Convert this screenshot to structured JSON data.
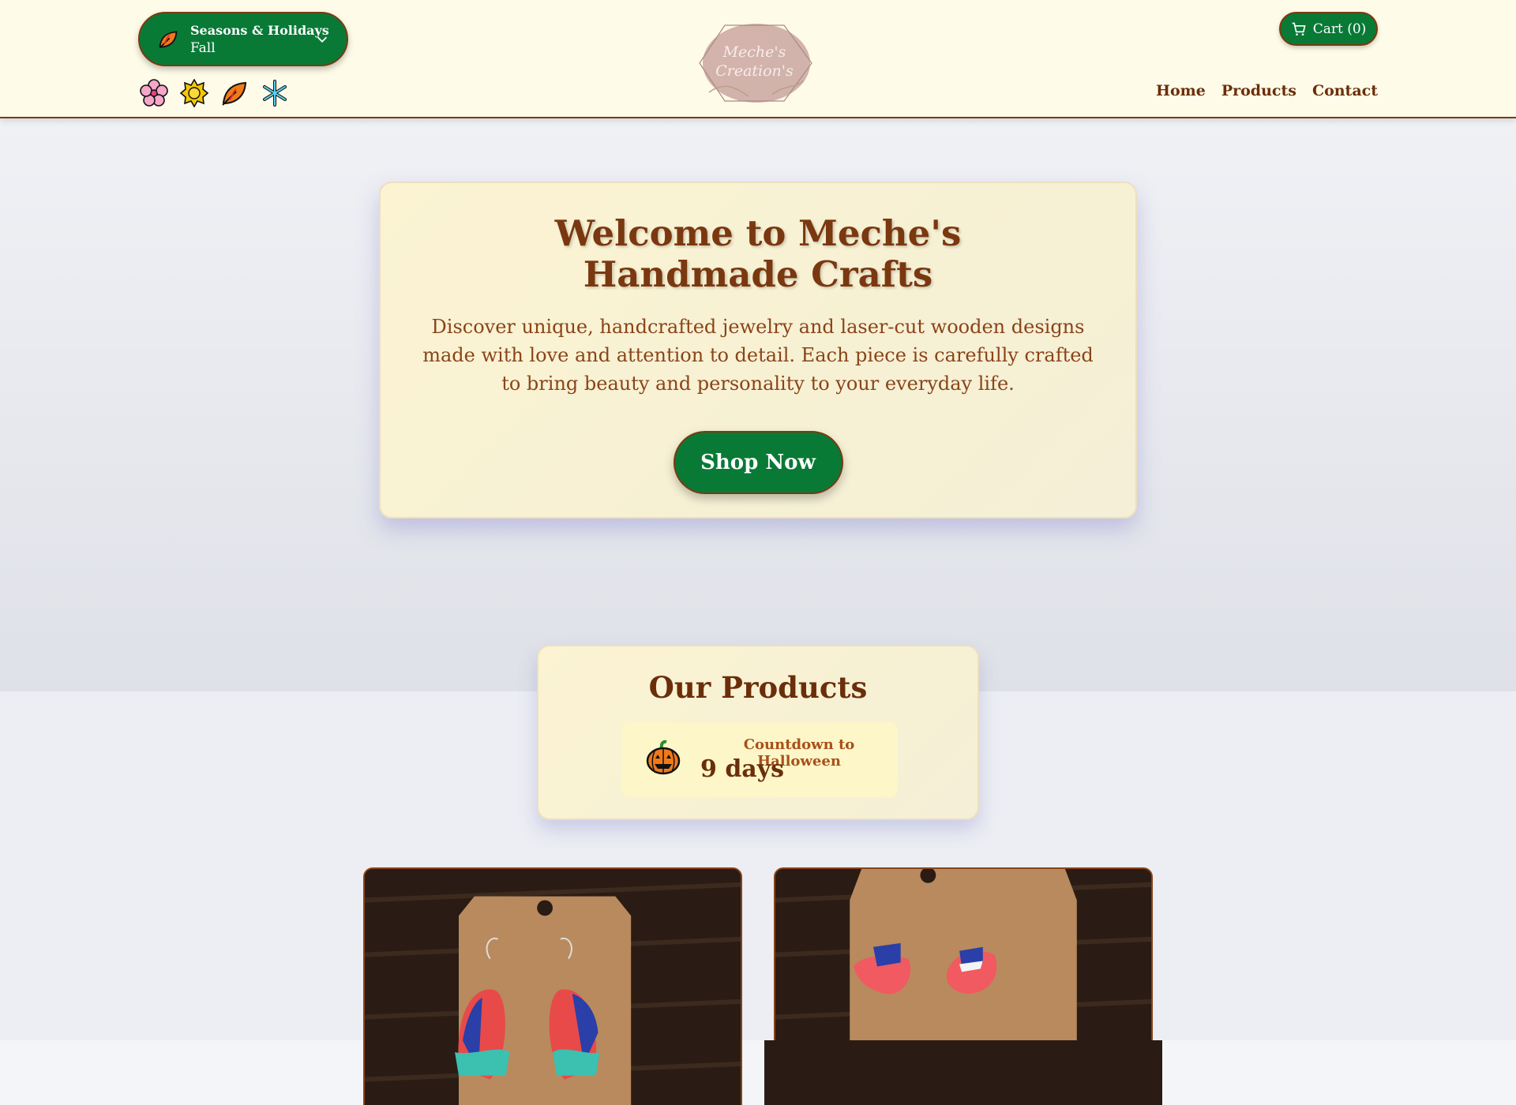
{
  "header": {
    "season_select": {
      "title": "Seasons & Holidays",
      "value": "Fall"
    },
    "season_icons": [
      "flower-icon",
      "sun-icon",
      "leaf-icon",
      "snowflake-icon"
    ],
    "logo": {
      "line1": "Meche's",
      "line2": "Creation's"
    },
    "cart_label": "Cart (0)",
    "nav": [
      "Home",
      "Products",
      "Contact"
    ]
  },
  "hero": {
    "title": "Welcome to Meche's Handmade Crafts",
    "description": "Discover unique, handcrafted jewelry and laser-cut wooden designs made with love and attention to detail. Each piece is carefully crafted to bring beauty and personality to your everyday life.",
    "button": "Shop Now"
  },
  "products": {
    "title": "Our Products",
    "countdown": {
      "label": "Countdown to Halloween",
      "value": "9 days"
    }
  },
  "colors": {
    "primary_green": "#087a36",
    "brown": "#7a3810",
    "cream": "#fefbe8"
  }
}
